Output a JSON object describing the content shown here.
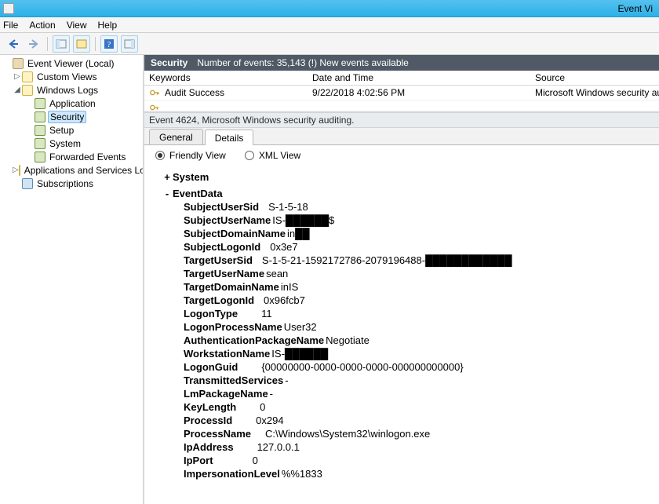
{
  "title_right": "Event Vi",
  "menubar": [
    "File",
    "Action",
    "View",
    "Help"
  ],
  "tree": {
    "root": "Event Viewer (Local)",
    "items": [
      {
        "label": "Custom Views",
        "expander": "▷",
        "iconClass": "ni-folder",
        "level": 1
      },
      {
        "label": "Windows Logs",
        "expander": "◢",
        "iconClass": "ni-folder",
        "level": 1
      },
      {
        "label": "Application",
        "expander": "",
        "iconClass": "ni-log",
        "level": 2
      },
      {
        "label": "Security",
        "expander": "",
        "iconClass": "ni-log",
        "level": 2,
        "selected": true
      },
      {
        "label": "Setup",
        "expander": "",
        "iconClass": "ni-log",
        "level": 2
      },
      {
        "label": "System",
        "expander": "",
        "iconClass": "ni-log",
        "level": 2
      },
      {
        "label": "Forwarded Events",
        "expander": "",
        "iconClass": "ni-log",
        "level": 2
      },
      {
        "label": "Applications and Services Lo",
        "expander": "▷",
        "iconClass": "ni-folder",
        "level": 1
      },
      {
        "label": "Subscriptions",
        "expander": "",
        "iconClass": "ni-sub",
        "level": 1
      }
    ]
  },
  "list_header": {
    "category": "Security",
    "text": "Number of events: 35,143 (!) New events available"
  },
  "grid": {
    "headers": [
      "Keywords",
      "Date and Time",
      "Source"
    ],
    "rows": [
      {
        "keywords": "Audit Success",
        "datetime": "9/22/2018 4:02:56 PM",
        "source": "Microsoft Windows security audit"
      }
    ]
  },
  "detail_header": "Event 4624, Microsoft Windows security auditing.",
  "tabs": {
    "general": "General",
    "details": "Details"
  },
  "view_radios": {
    "friendly": "Friendly View",
    "xml": "XML View"
  },
  "event": {
    "system_label": "System",
    "eventdata_label": "EventData",
    "data": [
      {
        "k": "SubjectUserSid",
        "v": "S-1-5-18",
        "gap": 12
      },
      {
        "k": "SubjectUserName",
        "v": "IS-██████$",
        "gap": 2
      },
      {
        "k": "SubjectDomainName",
        "v": "in██",
        "gap": 2
      },
      {
        "k": "SubjectLogonId",
        "v": "0x3e7",
        "gap": 12
      },
      {
        "k": "TargetUserSid",
        "v": "S-1-5-21-1592172786-2079196488-████████████",
        "gap": 12
      },
      {
        "k": "TargetUserName",
        "v": "sean",
        "gap": 2
      },
      {
        "k": "TargetDomainName",
        "v": "inIS",
        "gap": 2
      },
      {
        "k": "TargetLogonId",
        "v": "0x96fcb7",
        "gap": 12
      },
      {
        "k": "LogonType",
        "v": "11",
        "gap": 30
      },
      {
        "k": "LogonProcessName",
        "v": "User32",
        "gap": 2
      },
      {
        "k": "AuthenticationPackageName",
        "v": "Negotiate",
        "gap": 2
      },
      {
        "k": "WorkstationName",
        "v": "IS-██████",
        "gap": 2
      },
      {
        "k": "LogonGuid",
        "v": "{00000000-0000-0000-0000-000000000000}",
        "gap": 30
      },
      {
        "k": "TransmittedServices",
        "v": "-",
        "gap": 2
      },
      {
        "k": "LmPackageName",
        "v": "-",
        "gap": 2
      },
      {
        "k": "KeyLength",
        "v": "0",
        "gap": 30
      },
      {
        "k": "ProcessId",
        "v": "0x294",
        "gap": 30
      },
      {
        "k": "ProcessName",
        "v": "C:\\Windows\\System32\\winlogon.exe",
        "gap": 18
      },
      {
        "k": "IpAddress",
        "v": "127.0.0.1",
        "gap": 30
      },
      {
        "k": "IpPort",
        "v": "0",
        "gap": 50
      },
      {
        "k": "ImpersonationLevel",
        "v": "%%1833",
        "gap": 2
      }
    ]
  }
}
